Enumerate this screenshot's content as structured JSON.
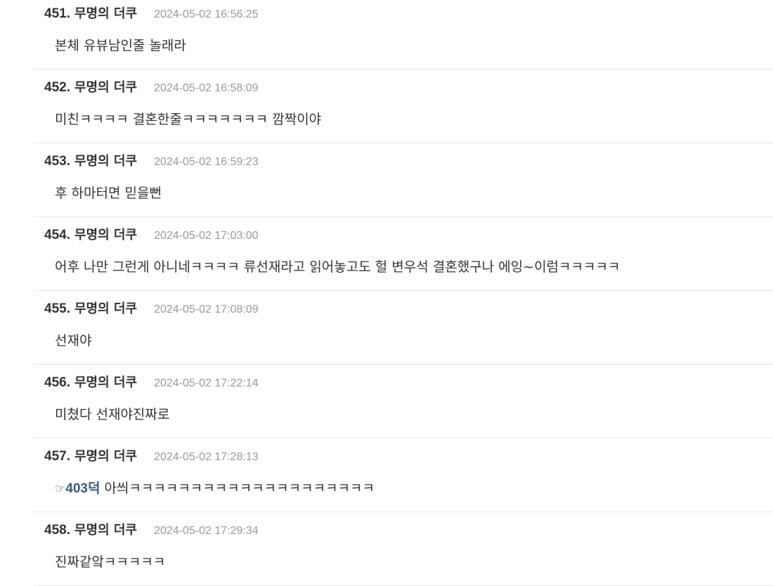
{
  "comments": [
    {
      "number": "451.",
      "author": "무명의 더쿠",
      "date": "2024-05-02 16:56:25",
      "text": "본체 유뷰남인줄 놀래라"
    },
    {
      "number": "452.",
      "author": "무명의 더쿠",
      "date": "2024-05-02 16:58:09",
      "text": "미친ㅋㅋㅋㅋ 결혼한줄ㅋㅋㅋㅋㅋㅋㅋ 깜짝이야"
    },
    {
      "number": "453.",
      "author": "무명의 더쿠",
      "date": "2024-05-02 16:59:23",
      "text": "후 하마터면 믿을뻔"
    },
    {
      "number": "454.",
      "author": "무명의 더쿠",
      "date": "2024-05-02 17:03:00",
      "text": "어후 나만 그런게 아니네ㅋㅋㅋㅋ 류선재라고 읽어놓고도 헐 변우석 결혼했구나 에잉~이럼ㅋㅋㅋㅋㅋ"
    },
    {
      "number": "455.",
      "author": "무명의 더쿠",
      "date": "2024-05-02 17:08:09",
      "text": "선재야"
    },
    {
      "number": "456.",
      "author": "무명의 더쿠",
      "date": "2024-05-02 17:22:14",
      "text": "미쳤다 선재야진짜로"
    },
    {
      "number": "457.",
      "author": "무명의 더쿠",
      "date": "2024-05-02 17:28:13",
      "reply_hand": "☞",
      "reply_ref": "403덕",
      "text": "아씌ㅋㅋㅋㅋㅋㅋㅋㅋㅋㅋㅋㅋㅋㅋㅋㅋㅋㅋㅋㅋ"
    },
    {
      "number": "458.",
      "author": "무명의 더쿠",
      "date": "2024-05-02 17:29:34",
      "text": "진짜같앜ㅋㅋㅋㅋㅋ"
    }
  ]
}
